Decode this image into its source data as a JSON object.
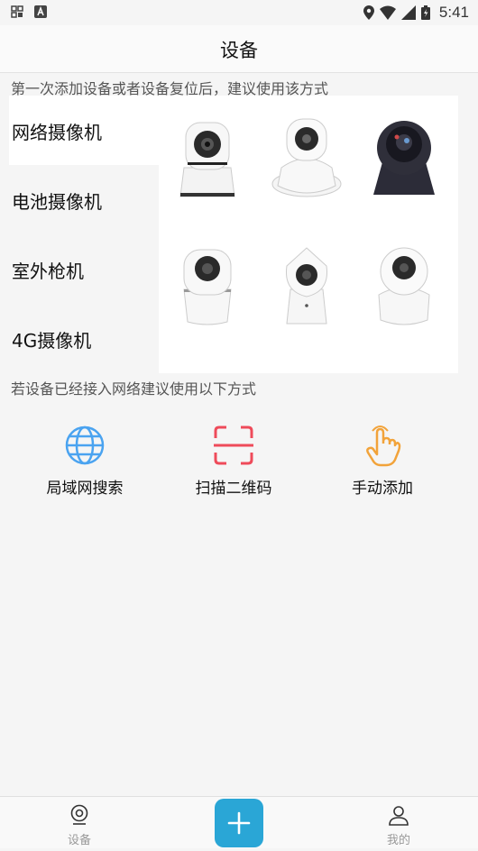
{
  "status_bar": {
    "time": "5:41"
  },
  "header": {
    "title": "设备"
  },
  "hint_top": "第一次添加设备或者设备复位后，建议使用该方式",
  "categories": [
    {
      "label": "网络摄像机",
      "active": true
    },
    {
      "label": "电池摄像机",
      "active": false
    },
    {
      "label": "室外枪机",
      "active": false
    },
    {
      "label": "4G摄像机",
      "active": false
    }
  ],
  "hint_bottom": "若设备已经接入网络建议使用以下方式",
  "actions": [
    {
      "label": "局域网搜索",
      "icon": "globe-icon",
      "color": "#4aa3f0"
    },
    {
      "label": "扫描二维码",
      "icon": "qr-scan-icon",
      "color": "#ee4b5a"
    },
    {
      "label": "手动添加",
      "icon": "hand-tap-icon",
      "color": "#f2a33a"
    }
  ],
  "tabbar": {
    "devices_label": "设备",
    "mine_label": "我的",
    "fab_color": "#2aa6d6"
  }
}
